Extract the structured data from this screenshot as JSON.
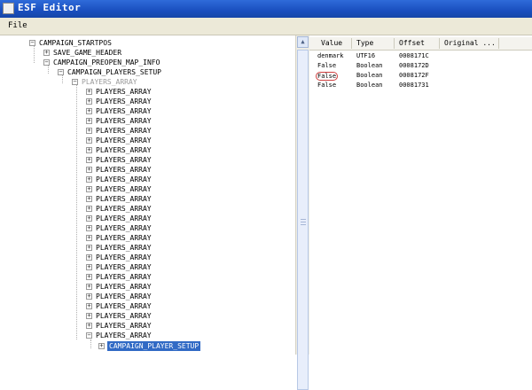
{
  "window": {
    "title": "ESF Editor"
  },
  "menu": {
    "file": "File"
  },
  "tree": {
    "root": "CAMPAIGN_STARTPOS",
    "save_game_header": "SAVE_GAME_HEADER",
    "preopen_map_info": "CAMPAIGN_PREOPEN_MAP_INFO",
    "players_setup": "CAMPAIGN_PLAYERS_SETUP",
    "players_array_group": "PLAYERS_ARRAY",
    "players_array_items": [
      "PLAYERS_ARRAY",
      "PLAYERS_ARRAY",
      "PLAYERS_ARRAY",
      "PLAYERS_ARRAY",
      "PLAYERS_ARRAY",
      "PLAYERS_ARRAY",
      "PLAYERS_ARRAY",
      "PLAYERS_ARRAY",
      "PLAYERS_ARRAY",
      "PLAYERS_ARRAY",
      "PLAYERS_ARRAY",
      "PLAYERS_ARRAY",
      "PLAYERS_ARRAY",
      "PLAYERS_ARRAY",
      "PLAYERS_ARRAY",
      "PLAYERS_ARRAY",
      "PLAYERS_ARRAY",
      "PLAYERS_ARRAY",
      "PLAYERS_ARRAY",
      "PLAYERS_ARRAY",
      "PLAYERS_ARRAY",
      "PLAYERS_ARRAY",
      "PLAYERS_ARRAY",
      "PLAYERS_ARRAY",
      "PLAYERS_ARRAY",
      "PLAYERS_ARRAY"
    ],
    "selected_child": "CAMPAIGN_PLAYER_SETUP"
  },
  "grid": {
    "columns": [
      "Value",
      "Type",
      "Offset",
      "Original ..."
    ],
    "rows": [
      {
        "value": "denmark",
        "type": "UTF16",
        "offset": "0008171C"
      },
      {
        "value": "False",
        "type": "Boolean",
        "offset": "0008172D"
      },
      {
        "value": "False",
        "type": "Boolean",
        "offset": "0008172F"
      },
      {
        "value": "False",
        "type": "Boolean",
        "offset": "00081731"
      }
    ]
  }
}
